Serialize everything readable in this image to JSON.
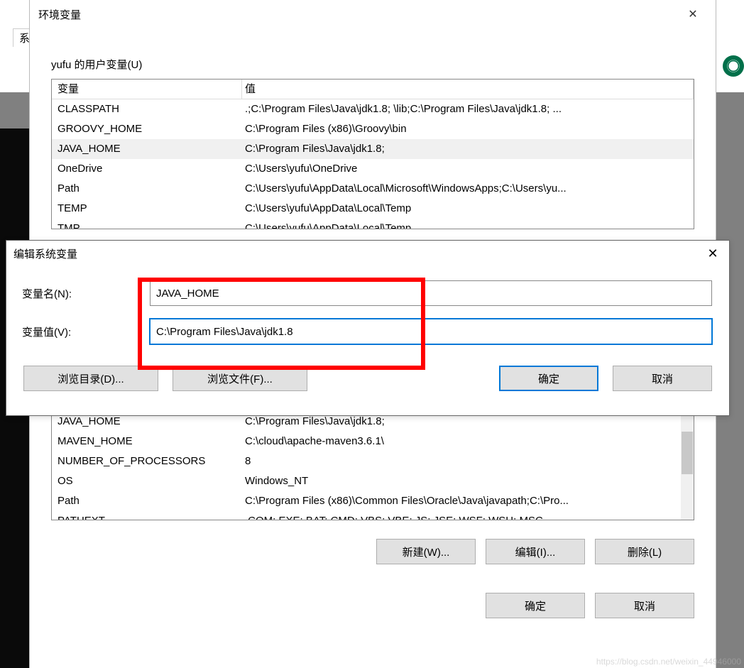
{
  "envWindow": {
    "title": "环境变量",
    "userSectionLabel": "yufu 的用户变量(U)",
    "headers": {
      "var": "变量",
      "val": "值"
    },
    "userVars": [
      {
        "name": "CLASSPATH",
        "value": ".;C:\\Program Files\\Java\\jdk1.8;  \\lib;C:\\Program Files\\Java\\jdk1.8; ...",
        "selected": false
      },
      {
        "name": "GROOVY_HOME",
        "value": "C:\\Program Files (x86)\\Groovy\\bin",
        "selected": false
      },
      {
        "name": "JAVA_HOME",
        "value": "C:\\Program Files\\Java\\jdk1.8;",
        "selected": true
      },
      {
        "name": "OneDrive",
        "value": "C:\\Users\\yufu\\OneDrive",
        "selected": false
      },
      {
        "name": "Path",
        "value": "C:\\Users\\yufu\\AppData\\Local\\Microsoft\\WindowsApps;C:\\Users\\yu...",
        "selected": false
      },
      {
        "name": "TEMP",
        "value": "C:\\Users\\yufu\\AppData\\Local\\Temp",
        "selected": false
      },
      {
        "name": "TMP",
        "value": "C:\\Users\\yufu\\AppData\\Local\\Temp",
        "selected": false
      }
    ],
    "sysVars": [
      {
        "name": "JAVA_HOME",
        "value": "C:\\Program Files\\Java\\jdk1.8;"
      },
      {
        "name": "MAVEN_HOME",
        "value": "C:\\cloud\\apache-maven3.6.1\\"
      },
      {
        "name": "NUMBER_OF_PROCESSORS",
        "value": "8"
      },
      {
        "name": "OS",
        "value": "Windows_NT"
      },
      {
        "name": "Path",
        "value": "C:\\Program Files (x86)\\Common Files\\Oracle\\Java\\javapath;C:\\Pro..."
      },
      {
        "name": "PATHEXT",
        "value": ".COM;.EXE;.BAT;.CMD;.VBS;.VBE;.JS;.JSE;.WSF;.WSH;.MSC"
      }
    ],
    "buttons": {
      "new": "新建(W)...",
      "edit": "编辑(I)...",
      "delete": "删除(L)",
      "ok": "确定",
      "cancel": "取消"
    }
  },
  "editDialog": {
    "title": "编辑系统变量",
    "nameLabel": "变量名(N):",
    "valueLabel": "变量值(V):",
    "nameValue": "JAVA_HOME",
    "valueValue": "C:\\Program Files\\Java\\jdk1.8",
    "browseDir": "浏览目录(D)...",
    "browseFile": "浏览文件(F)...",
    "ok": "确定",
    "cancel": "取消"
  },
  "backTab": "系",
  "watermark": "https://blog.csdn.net/weixin_44946000"
}
